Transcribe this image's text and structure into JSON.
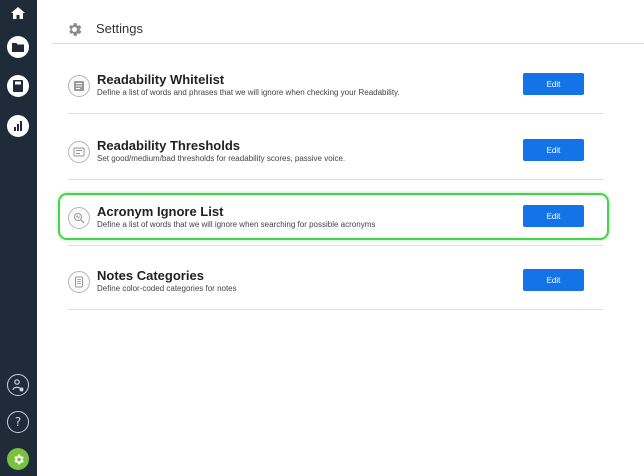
{
  "header": {
    "title": "Settings",
    "icon": "gear-icon"
  },
  "sidebar": {
    "top_items": [
      {
        "name": "home",
        "icon": "home-icon"
      },
      {
        "name": "folder",
        "icon": "folder-icon"
      },
      {
        "name": "save",
        "icon": "save-icon"
      },
      {
        "name": "stats",
        "icon": "bar-chart-icon"
      }
    ],
    "bottom_items": [
      {
        "name": "user-settings",
        "icon": "user-gear-icon"
      },
      {
        "name": "help",
        "icon": "help-icon"
      },
      {
        "name": "settings",
        "icon": "gear-icon",
        "active": true
      }
    ],
    "colors": {
      "background": "#1f2b38",
      "active": "#7ac143"
    }
  },
  "settings": [
    {
      "title": "Readability Whitelist",
      "description": "Define a list of words and phrases that we will ignore when checking your Readability.",
      "edit_label": "Edit",
      "icon": "list-icon"
    },
    {
      "title": "Readability Thresholds",
      "description": "Set good/medium/bad thresholds for readability scores, passive voice.",
      "edit_label": "Edit",
      "icon": "sliders-icon"
    },
    {
      "title": "Acronym Ignore List",
      "description": "Define a list of words that we will ignore when searching for possible acronyms",
      "edit_label": "Edit",
      "icon": "magnifier-icon",
      "highlighted": true
    },
    {
      "title": "Notes Categories",
      "description": "Define color-coded categories for notes",
      "edit_label": "Edit",
      "icon": "notes-icon"
    }
  ],
  "colors": {
    "button": "#1473e6",
    "highlight": "#44d44a"
  }
}
